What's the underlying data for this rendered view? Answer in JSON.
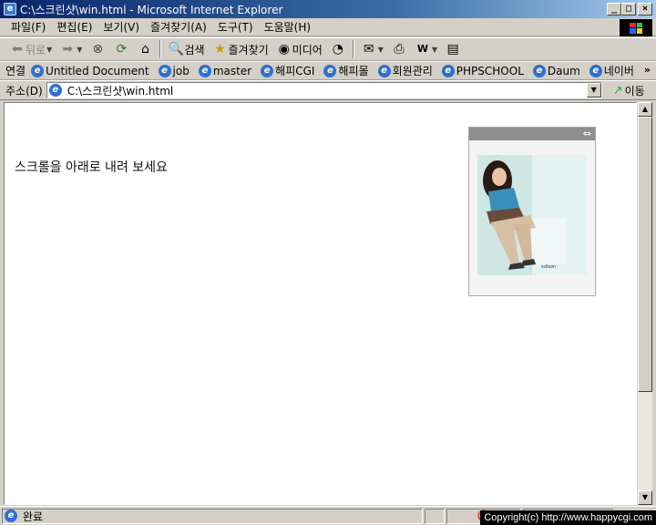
{
  "window": {
    "title": "C:\\스크린샷\\win.html - Microsoft Internet Explorer",
    "app_icon": "ie-icon",
    "controls": {
      "minimize": "_",
      "maximize": "□",
      "close": "×"
    }
  },
  "menu": [
    "파일(F)",
    "편집(E)",
    "보기(V)",
    "즐겨찾기(A)",
    "도구(T)",
    "도움말(H)"
  ],
  "toolbar": {
    "back_label": "뒤로",
    "search_label": "검색",
    "favorites_label": "즐겨찾기",
    "media_label": "미디어"
  },
  "links": {
    "label": "연결",
    "items": [
      "Untitled Document",
      "job",
      "master",
      "해피CGI",
      "해피몰",
      "회원관리",
      "PHPSCHOOL",
      "Daum",
      "네이버"
    ],
    "overflow": "»"
  },
  "address": {
    "label": "주소(D)",
    "value": "C:\\스크린샷\\win.html",
    "go_label": "이동"
  },
  "content": {
    "message": "스크롤을 아래로 내려 보세요",
    "ad_close_glyph": "⇔"
  },
  "status": {
    "text": "완료"
  },
  "watermark": "Copyright(c) http://www.happycgi.com"
}
